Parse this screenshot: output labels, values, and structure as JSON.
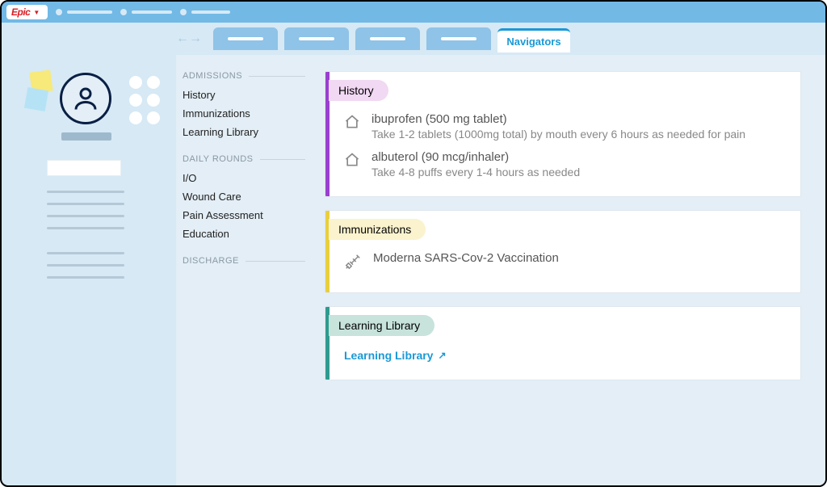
{
  "header": {
    "brand": "Epic",
    "active_tab_label": "Navigators"
  },
  "nav": {
    "sections": [
      {
        "header": "ADMISSIONS",
        "items": [
          "History",
          "Immunizations",
          "Learning Library"
        ]
      },
      {
        "header": "DAILY ROUNDS",
        "items": [
          "I/O",
          "Wound Care",
          "Pain Assessment",
          "Education"
        ]
      },
      {
        "header": "DISCHARGE",
        "items": []
      }
    ]
  },
  "cards": {
    "history": {
      "title": "History",
      "items": [
        {
          "name": "ibuprofen (500 mg tablet)",
          "dose": "Take 1-2 tablets (1000mg total) by mouth every 6 hours as needed for pain",
          "icon": "home-icon"
        },
        {
          "name": "albuterol (90 mcg/inhaler)",
          "dose": "Take 4-8 puffs every 1-4 hours as needed",
          "icon": "home-icon"
        }
      ]
    },
    "immunizations": {
      "title": "Immunizations",
      "items": [
        {
          "name": "Moderna SARS-Cov-2 Vaccination",
          "icon": "syringe-icon"
        }
      ]
    },
    "library": {
      "title": "Learning Library",
      "link_label": "Learning Library"
    }
  }
}
